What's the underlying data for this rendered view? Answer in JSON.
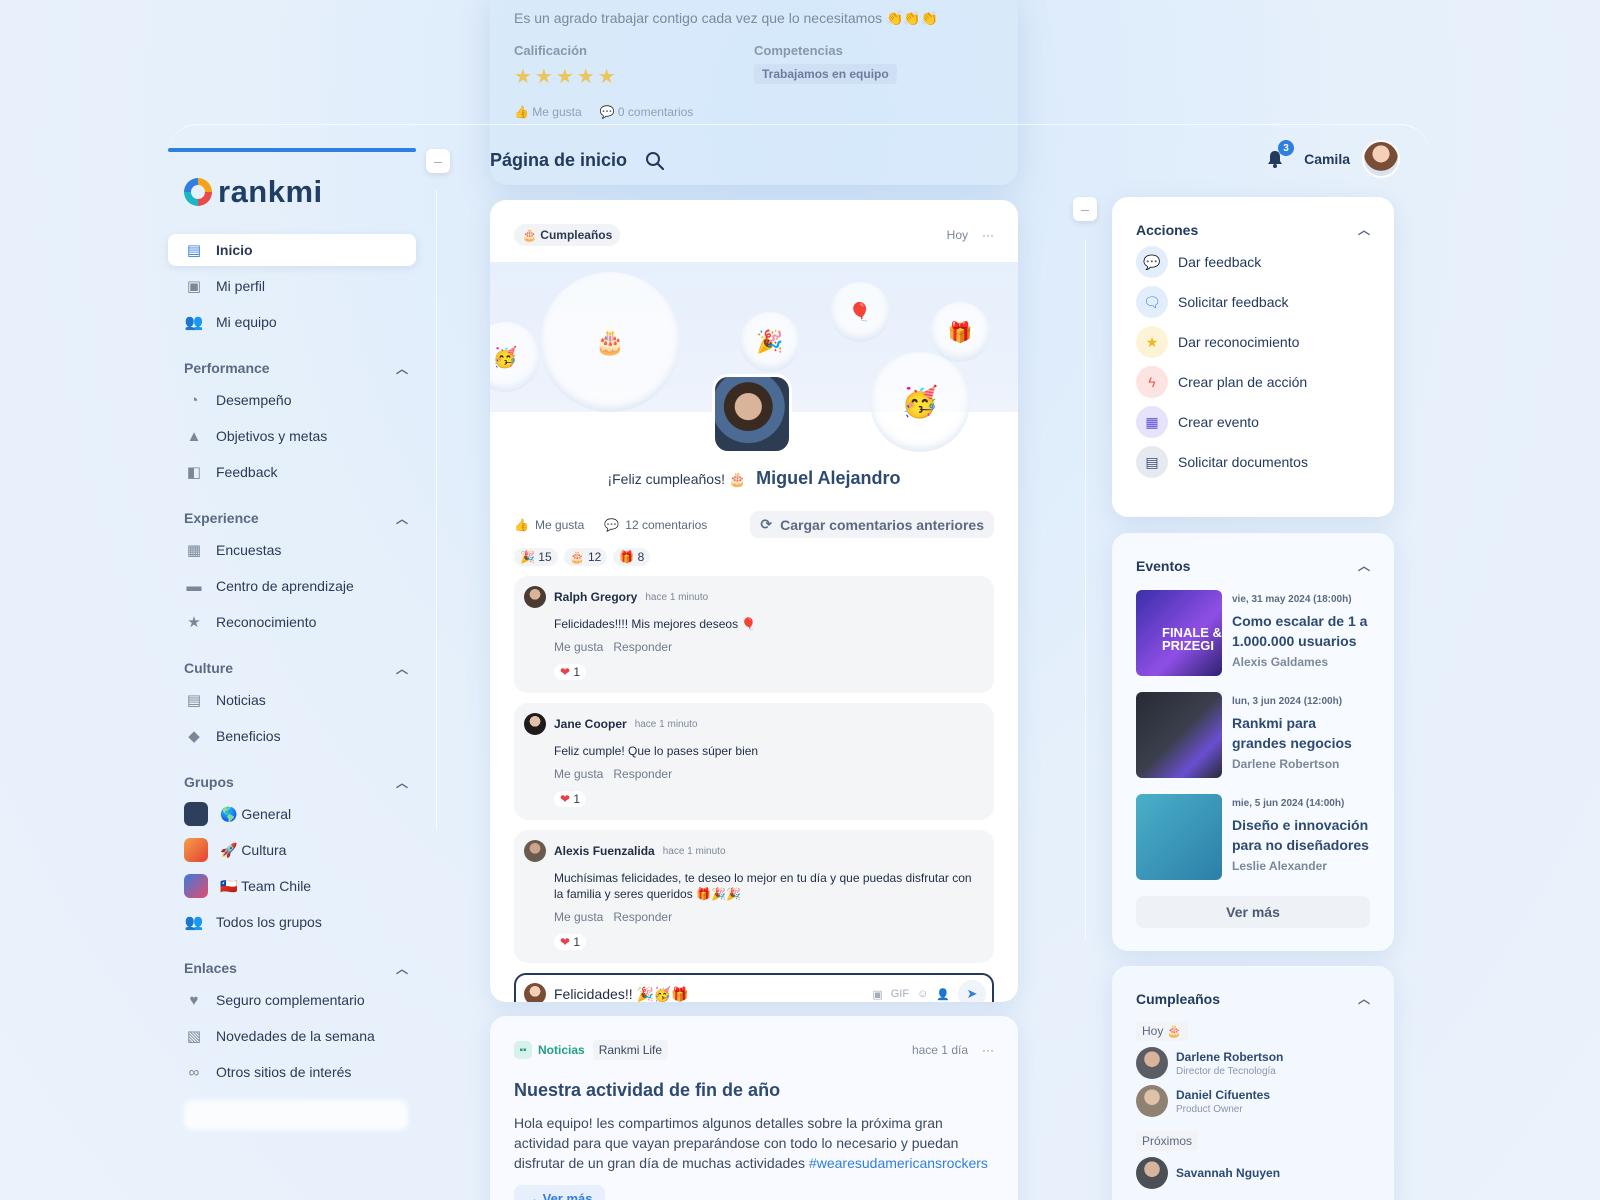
{
  "ghost": {
    "text": "Es un agrado trabajar contigo cada vez que lo necesitamos 👏👏👏",
    "rating_label": "Calificación",
    "competencias_label": "Competencias",
    "stars": "★★★★★",
    "competencia": "Trabajamos en equipo",
    "like": "Me gusta",
    "comments": "0 comentarios"
  },
  "header": {
    "title": "Página de inicio",
    "notif_count": "3",
    "user_name": "Camila"
  },
  "sidebar": {
    "logo": "rankmi",
    "main": [
      {
        "label": "Inicio",
        "icon": "home-icon"
      },
      {
        "label": "Mi perfil",
        "icon": "profile-icon"
      },
      {
        "label": "Mi equipo",
        "icon": "team-icon"
      }
    ],
    "sections": [
      {
        "title": "Performance",
        "items": [
          "Desempeño",
          "Objetivos y metas",
          "Feedback"
        ]
      },
      {
        "title": "Experience",
        "items": [
          "Encuestas",
          "Centro de aprendizaje",
          "Reconocimiento"
        ]
      },
      {
        "title": "Culture",
        "items": [
          "Noticias",
          "Beneficios"
        ]
      },
      {
        "title": "Grupos",
        "items": [
          "🌎 General",
          "🚀 Cultura",
          "🇨🇱 Team Chile",
          "Todos los grupos"
        ]
      },
      {
        "title": "Enlaces",
        "items": [
          "Seguro complementario",
          "Novedades de la semana",
          "Otros sitios de interés"
        ]
      }
    ]
  },
  "post": {
    "tag": "🎂 Cumpleaños",
    "time": "Hoy",
    "greeting": "¡Feliz cumpleaños! 🎂",
    "name": "Miguel Alejandro",
    "like": "Me gusta",
    "comments": "12 comentarios",
    "load_more": "Cargar comentarios anteriores",
    "reactions": [
      {
        "emoji": "🎉",
        "count": "15"
      },
      {
        "emoji": "🎂",
        "count": "12"
      },
      {
        "emoji": "🎁",
        "count": "8"
      }
    ],
    "comment_list": [
      {
        "name": "Ralph Gregory",
        "time": "hace 1 minuto",
        "text": "Felicidades!!!! Mis mejores deseos 🎈",
        "like": "Me gusta",
        "reply": "Responder",
        "hearts": "1"
      },
      {
        "name": "Jane Cooper",
        "time": "hace 1 minuto",
        "text": "Feliz cumple! Que lo pases súper bien",
        "like": "Me gusta",
        "reply": "Responder",
        "hearts": "1"
      },
      {
        "name": "Alexis Fuenzalida",
        "time": "hace 1 minuto",
        "text": "Muchísimas felicidades, te deseo lo mejor en tu día y que puedas disfrutar con la familia y seres queridos 🎁🎉🎉",
        "like": "Me gusta",
        "reply": "Responder",
        "hearts": "1"
      }
    ],
    "compose_value": "Felicidades!! 🎉🥳🎁",
    "gif": "GIF"
  },
  "news": {
    "tag": "Noticias",
    "chip": "Rankmi Life",
    "time": "hace 1 día",
    "title": "Nuestra actividad de fin de año",
    "body": "Hola equipo! les compartimos algunos detalles sobre la próxima gran actividad para que vayan preparándose con todo lo necesario y puedan disfrutar de un gran día de muchas actividades ",
    "hashtag": "#wearesudamericansrockers",
    "more": "Ver más"
  },
  "acciones": {
    "title": "Acciones",
    "items": [
      {
        "label": "Dar feedback",
        "icon": "chat-icon",
        "bg": "#e3eefc",
        "color": "#2f7fe0"
      },
      {
        "label": "Solicitar feedback",
        "icon": "chat-request-icon",
        "bg": "#e3eefc",
        "color": "#2f7fe0"
      },
      {
        "label": "Dar reconocimiento",
        "icon": "star-icon",
        "bg": "#fdf3d6",
        "color": "#f2b619"
      },
      {
        "label": "Crear plan de acción",
        "icon": "bolt-icon",
        "bg": "#fde3e1",
        "color": "#ec5a4a"
      },
      {
        "label": "Crear evento",
        "icon": "calendar-icon",
        "bg": "#e6e4fb",
        "color": "#5b4fd6"
      },
      {
        "label": "Solicitar documentos",
        "icon": "document-icon",
        "bg": "#e6e9ef",
        "color": "#3b4a74"
      }
    ]
  },
  "eventos": {
    "title": "Eventos",
    "items": [
      {
        "date": "vie, 31 may 2024 (18:00h)",
        "title": "Como escalar de 1 a 1.000.000 usuarios",
        "host": "Alexis Galdames",
        "img_text": "FINALE & PRIZEGI"
      },
      {
        "date": "lun, 3 jun 2024 (12:00h)",
        "title": "Rankmi para grandes negocios",
        "host": "Darlene Robertson",
        "img_text": ""
      },
      {
        "date": "mie, 5 jun 2024 (14:00h)",
        "title": "Diseño e innovación para no diseñadores",
        "host": "Leslie Alexander",
        "img_text": ""
      }
    ],
    "more": "Ver más"
  },
  "cumpleanos": {
    "title": "Cumpleaños",
    "today_label": "Hoy 🎂",
    "today": [
      {
        "name": "Darlene Robertson",
        "role": "Director de Tecnología"
      },
      {
        "name": "Daniel Cifuentes",
        "role": "Product Owner"
      }
    ],
    "upcoming_label": "Próximos",
    "upcoming": [
      {
        "name": "Savannah Nguyen",
        "role": ""
      }
    ]
  }
}
